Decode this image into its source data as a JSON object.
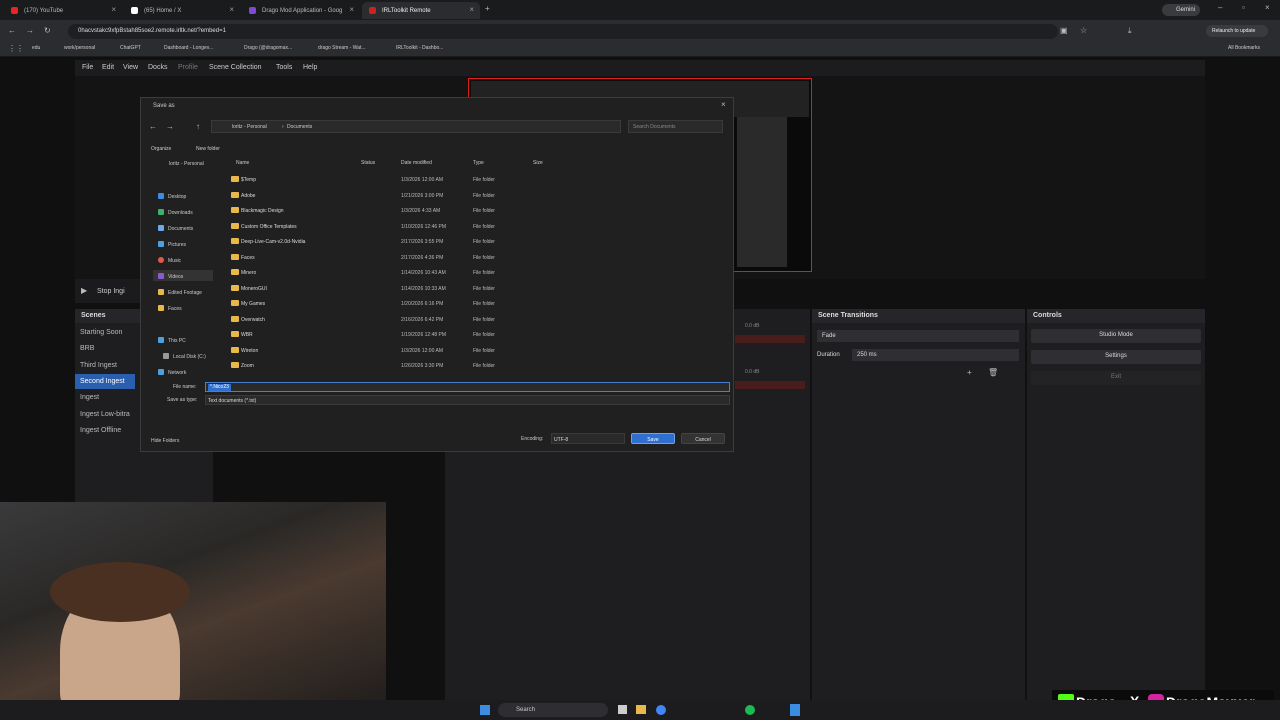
{
  "browser": {
    "tabs": [
      {
        "label": "(170) YouTube"
      },
      {
        "label": "(65) Home / X"
      },
      {
        "label": "Drago Mod Application - Goog"
      },
      {
        "label": "IRLToolkit Remote"
      }
    ],
    "profile": "Gemini",
    "url": "0hacvstakc9xfpBstah85soe2.remote.irltk.net/?embed=1",
    "relaunch": "Relaunch to update",
    "bookmarks": [
      "edu",
      "work/personal",
      "ChatGPT",
      "Dashboard - Longev...",
      "Drago (@dragomax...",
      "drago Stream - Wat...",
      "IRLToolkit - Dashbo..."
    ],
    "all_bookmarks": "All Bookmarks"
  },
  "obs": {
    "menu": [
      "File",
      "Edit",
      "View",
      "Docks",
      "Profile",
      "Scene Collection",
      "Tools",
      "Help"
    ],
    "studio_label": "Stop Ingi",
    "scenes_title": "Scenes",
    "scenes": [
      "Starting Soon",
      "BRB",
      "Third Ingest",
      "Second Ingest",
      "Ingest",
      "Ingest Low-bitra",
      "Ingest Offline"
    ],
    "active_scene": "Second Ingest",
    "transitions_title": "Scene Transitions",
    "transition": "Fade",
    "duration_label": "Duration",
    "duration_value": "250 ms",
    "controls_title": "Controls",
    "controls": [
      "Studio Mode",
      "Settings",
      "Exit"
    ],
    "db1": "0.0 dB",
    "db2": "0.0 dB"
  },
  "dialog": {
    "title": "Save as",
    "breadcrumb": [
      "loritz - Personal",
      "Documents"
    ],
    "search_placeholder": "Search Documents",
    "organize": "Organize",
    "new_folder": "New folder",
    "columns": {
      "name": "Name",
      "status": "Status",
      "date": "Date modified",
      "type": "Type",
      "size": "Size"
    },
    "nav_top": "loritz - Personal",
    "nav": [
      "Desktop",
      "Downloads",
      "Documents",
      "Pictures",
      "Music",
      "Videos",
      "Edited Footage",
      "Faces"
    ],
    "this_pc": "This PC",
    "local_disk": "Local Disk (C:)",
    "network": "Network",
    "files": [
      {
        "name": "$Temp",
        "date": "1/3/2026 12:00 AM",
        "type": "File folder"
      },
      {
        "name": "Adobe",
        "date": "1/21/2026 3:00 PM",
        "type": "File folder"
      },
      {
        "name": "Blackmagic Design",
        "date": "1/3/2026 4:33 AM",
        "type": "File folder"
      },
      {
        "name": "Custom Office Templates",
        "date": "1/10/2026 12:46 PM",
        "type": "File folder"
      },
      {
        "name": "Deep-Live-Cam-v2.0d-Nvidia",
        "date": "2/17/2026 3:55 PM",
        "type": "File folder"
      },
      {
        "name": "Faces",
        "date": "2/17/2026 4:36 PM",
        "type": "File folder"
      },
      {
        "name": "Minero",
        "date": "1/14/2026 10:43 AM",
        "type": "File folder"
      },
      {
        "name": "MoneroGUI",
        "date": "1/14/2026 10:33 AM",
        "type": "File folder"
      },
      {
        "name": "My Games",
        "date": "1/20/2026 6:16 PM",
        "type": "File folder"
      },
      {
        "name": "Overwatch",
        "date": "2/16/2026 6:42 PM",
        "type": "File folder"
      },
      {
        "name": "WBR",
        "date": "1/19/2026 12:48 PM",
        "type": "File folder"
      },
      {
        "name": "Wireton",
        "date": "1/3/2026 12:00 AM",
        "type": "File folder"
      },
      {
        "name": "Zoom",
        "date": "1/26/2026 3:30 PM",
        "type": "File folder"
      }
    ],
    "filename_label": "File name:",
    "filename_value": "*.Nico23",
    "type_label": "Save as type:",
    "type_value": "Text documents (*.txt)",
    "hide_folders": "Hide Folders",
    "encoding_label": "Encoding:",
    "encoding_value": "UTF-8",
    "save": "Save",
    "cancel": "Cancel"
  },
  "taskbar": {
    "search": "Search"
  },
  "overlay": {
    "kick_name": "Drago",
    "ig_name": "DragoMaxxer"
  }
}
